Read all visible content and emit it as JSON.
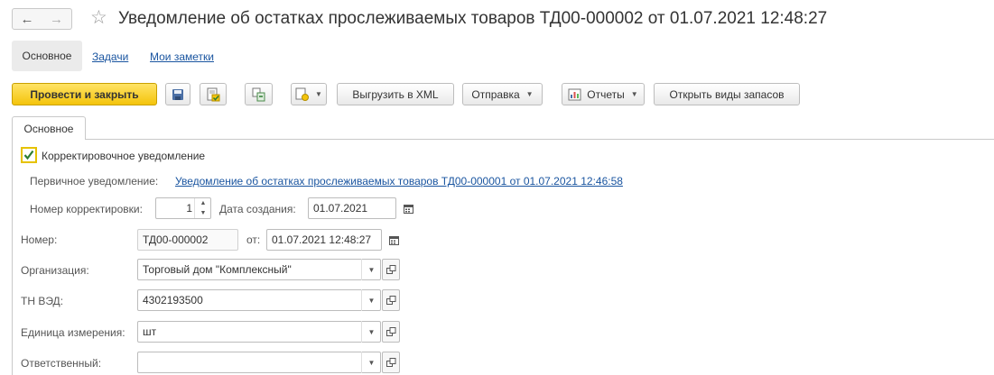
{
  "window": {
    "title": "Уведомление об остатках прослеживаемых товаров ТД00-000002 от 01.07.2021 12:48:27"
  },
  "nav_tabs": [
    {
      "label": "Основное",
      "active": true
    },
    {
      "label": "Задачи",
      "active": false
    },
    {
      "label": "Мои заметки",
      "active": false
    }
  ],
  "toolbar": {
    "post_and_close": "Провести и закрыть",
    "export_xml": "Выгрузить в XML",
    "send": "Отправка",
    "reports": "Отчеты",
    "open_stock_types": "Открыть виды запасов"
  },
  "form_tab": "Основное",
  "form": {
    "corrective_label": "Корректировочное уведомление",
    "corrective_checked": true,
    "primary_label": "Первичное уведомление:",
    "primary_link": "Уведомление об остатках прослеживаемых товаров ТД00-000001 от 01.07.2021 12:46:58",
    "correction_number_label": "Номер корректировки:",
    "correction_number": "1",
    "created_date_label": "Дата создания:",
    "created_date": "01.07.2021",
    "number_label": "Номер:",
    "number": "ТД00-000002",
    "from_label": "от:",
    "from_date": "01.07.2021 12:48:27",
    "organization_label": "Организация:",
    "organization": "Торговый дом \"Комплексный\"",
    "tnved_label": "ТН ВЭД:",
    "tnved": "4302193500",
    "unit_label": "Единица измерения:",
    "unit": "шт",
    "responsible_label": "Ответственный:",
    "responsible": ""
  },
  "icons": {
    "back": "arrow-left-icon",
    "forward": "arrow-right-icon",
    "favorite": "star-icon",
    "save": "floppy-disk-icon",
    "post": "post-document-icon",
    "structure": "related-documents-icon",
    "create_based": "create-based-on-icon",
    "reports": "report-icon",
    "calendar": "calendar-icon",
    "open": "open-form-icon"
  },
  "colors": {
    "primary_button": "#f4c40b",
    "link": "#1a55a0",
    "checkbox_check": "#2e7d32"
  }
}
